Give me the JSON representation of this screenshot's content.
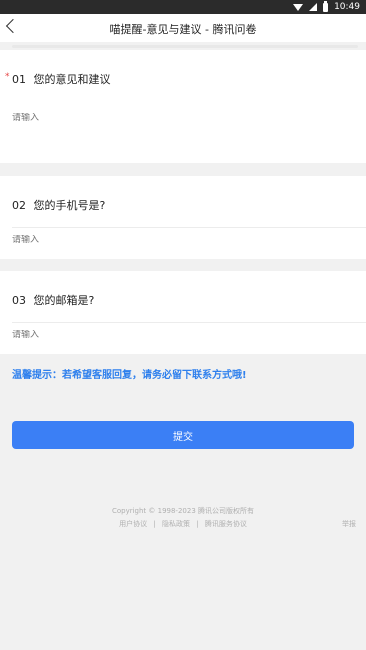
{
  "status_bar": {
    "time": "10:49"
  },
  "nav": {
    "title": "喵提醒-意见与建议 - 腾讯问卷"
  },
  "questions": [
    {
      "number": "01",
      "label": "您的意见和建议",
      "required_mark": "*",
      "placeholder": "请输入"
    },
    {
      "number": "02",
      "label": "您的手机号是?",
      "placeholder": "请输入"
    },
    {
      "number": "03",
      "label": "您的邮箱是?",
      "placeholder": "请输入"
    }
  ],
  "tip": "温馨提示：若希望客服回复，请务必留下联系方式哦!",
  "submit_label": "提交",
  "footer": {
    "copyright": "Copyright © 1998-2023 腾讯公司版权所有",
    "links": [
      "用户协议",
      "隐私政策",
      "腾讯服务协议"
    ],
    "separator": "|",
    "report": "举报"
  },
  "colors": {
    "accent": "#3b7ff5",
    "tip": "#2f80ed",
    "required": "#e54545"
  },
  "icons": [
    "back-arrow-icon",
    "wifi-icon",
    "signal-icon",
    "battery-icon"
  ]
}
